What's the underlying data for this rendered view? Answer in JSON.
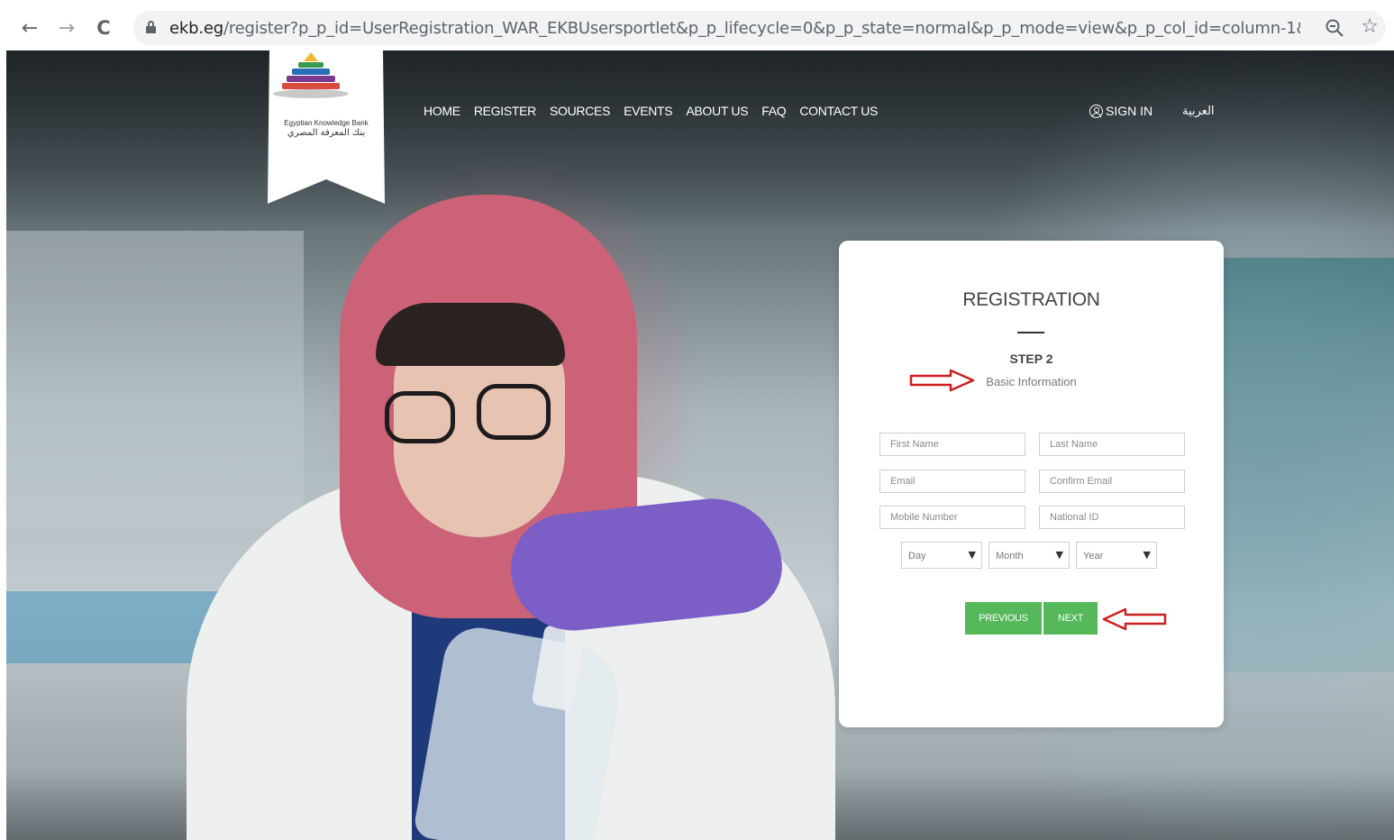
{
  "browser": {
    "back_glyph": "←",
    "forward_glyph": "→",
    "reload_glyph": "C",
    "url_host": "ekb.eg",
    "url_rest": "/register?p_p_id=UserRegistration_WAR_EKBUsersportlet&p_p_lifecycle=0&p_p_state=normal&p_p_mode=view&p_p_col_id=column-1&p_p_col_count...",
    "icons": [
      "back-icon",
      "forward-icon",
      "reload-icon",
      "lock-icon",
      "zoom-icon",
      "star-icon"
    ]
  },
  "logo": {
    "english": "Egyptian Knowledge Bank",
    "arabic": "بنك المعرفة المصري"
  },
  "nav": {
    "items": [
      "HOME",
      "REGISTER",
      "SOURCES",
      "EVENTS",
      "ABOUT US",
      "FAQ",
      "CONTACT US"
    ],
    "sign_in": "SIGN IN",
    "language": "العربية"
  },
  "registration": {
    "title": "REGISTRATION",
    "step": "STEP 2",
    "step_subtitle": "Basic Information",
    "fields": {
      "first_name": "First Name",
      "last_name": "Last Name",
      "email": "Email",
      "confirm_email": "Confirm Email",
      "mobile": "Mobile Number",
      "national_id": "National ID"
    },
    "dob": {
      "day": "Day",
      "month": "Month",
      "year": "Year",
      "caret": "▼"
    },
    "buttons": {
      "previous": "PREVIOUS",
      "next": "NEXT"
    }
  },
  "colors": {
    "button_green": "#55b85b",
    "annotation_red": "#cc2020"
  }
}
